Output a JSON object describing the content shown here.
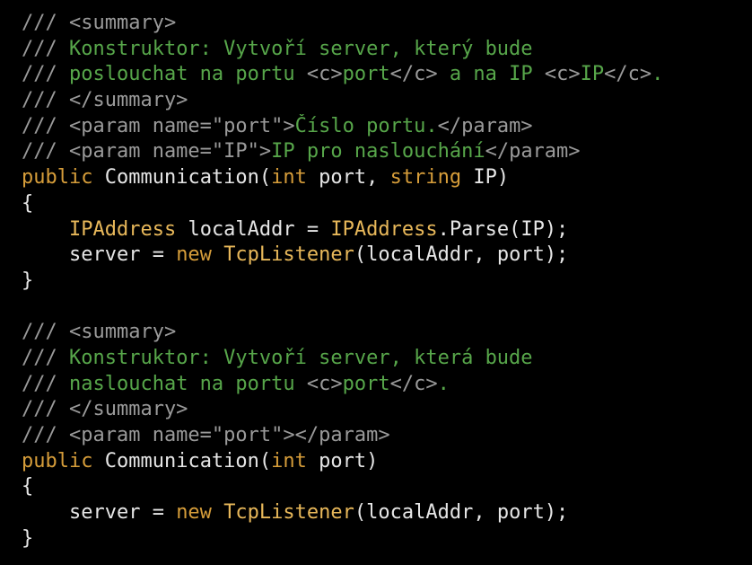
{
  "colors": {
    "background": "#000000",
    "doc_comment_markup": "#9a9a9a",
    "comment_text": "#57a64a",
    "keyword": "#d69d3a",
    "type": "#e8b85a",
    "identifier": "#e6e6e6"
  },
  "lines": [
    [
      {
        "t": "/// <summary>",
        "c": "gray"
      }
    ],
    [
      {
        "t": "/// ",
        "c": "gray"
      },
      {
        "t": "Konstruktor: Vytvoří server, který bude",
        "c": "green"
      }
    ],
    [
      {
        "t": "/// ",
        "c": "gray"
      },
      {
        "t": "poslouchat na portu ",
        "c": "green"
      },
      {
        "t": "<c>",
        "c": "gray"
      },
      {
        "t": "port",
        "c": "green"
      },
      {
        "t": "</c>",
        "c": "gray"
      },
      {
        "t": " a na IP ",
        "c": "green"
      },
      {
        "t": "<c>",
        "c": "gray"
      },
      {
        "t": "IP",
        "c": "green"
      },
      {
        "t": "</c>",
        "c": "gray"
      },
      {
        "t": ".",
        "c": "green"
      }
    ],
    [
      {
        "t": "/// </summary>",
        "c": "gray"
      }
    ],
    [
      {
        "t": "/// <param name=\"port\">",
        "c": "gray"
      },
      {
        "t": "Číslo portu.",
        "c": "green"
      },
      {
        "t": "</param>",
        "c": "gray"
      }
    ],
    [
      {
        "t": "/// <param name=\"IP\">",
        "c": "gray"
      },
      {
        "t": "IP pro naslouchání",
        "c": "green"
      },
      {
        "t": "</param>",
        "c": "gray"
      }
    ],
    [
      {
        "t": "public",
        "c": "kw"
      },
      {
        "t": " Communication(",
        "c": "white"
      },
      {
        "t": "int",
        "c": "kw"
      },
      {
        "t": " port, ",
        "c": "white"
      },
      {
        "t": "string",
        "c": "kw"
      },
      {
        "t": " IP)",
        "c": "white"
      }
    ],
    [
      {
        "t": "{",
        "c": "white"
      }
    ],
    [
      {
        "t": "    ",
        "c": "white"
      },
      {
        "t": "IPAddress",
        "c": "type"
      },
      {
        "t": " localAddr = ",
        "c": "white"
      },
      {
        "t": "IPAddress",
        "c": "type"
      },
      {
        "t": ".Parse(IP);",
        "c": "white"
      }
    ],
    [
      {
        "t": "    server = ",
        "c": "white"
      },
      {
        "t": "new",
        "c": "kw"
      },
      {
        "t": " ",
        "c": "white"
      },
      {
        "t": "TcpListener",
        "c": "type"
      },
      {
        "t": "(localAddr, port);",
        "c": "white"
      }
    ],
    [
      {
        "t": "}",
        "c": "white"
      }
    ],
    [
      {
        "t": "",
        "c": "white"
      }
    ],
    [
      {
        "t": "/// <summary>",
        "c": "gray"
      }
    ],
    [
      {
        "t": "/// ",
        "c": "gray"
      },
      {
        "t": "Konstruktor: Vytvoří server, která bude",
        "c": "green"
      }
    ],
    [
      {
        "t": "/// ",
        "c": "gray"
      },
      {
        "t": "naslouchat na portu ",
        "c": "green"
      },
      {
        "t": "<c>",
        "c": "gray"
      },
      {
        "t": "port",
        "c": "green"
      },
      {
        "t": "</c>",
        "c": "gray"
      },
      {
        "t": ".",
        "c": "green"
      }
    ],
    [
      {
        "t": "/// </summary>",
        "c": "gray"
      }
    ],
    [
      {
        "t": "/// <param name=\"port\"></param>",
        "c": "gray"
      }
    ],
    [
      {
        "t": "public",
        "c": "kw"
      },
      {
        "t": " Communication(",
        "c": "white"
      },
      {
        "t": "int",
        "c": "kw"
      },
      {
        "t": " port)",
        "c": "white"
      }
    ],
    [
      {
        "t": "{",
        "c": "white"
      }
    ],
    [
      {
        "t": "    server = ",
        "c": "white"
      },
      {
        "t": "new",
        "c": "kw"
      },
      {
        "t": " ",
        "c": "white"
      },
      {
        "t": "TcpListener",
        "c": "type"
      },
      {
        "t": "(localAddr, port);",
        "c": "white"
      }
    ],
    [
      {
        "t": "}",
        "c": "white"
      }
    ]
  ]
}
